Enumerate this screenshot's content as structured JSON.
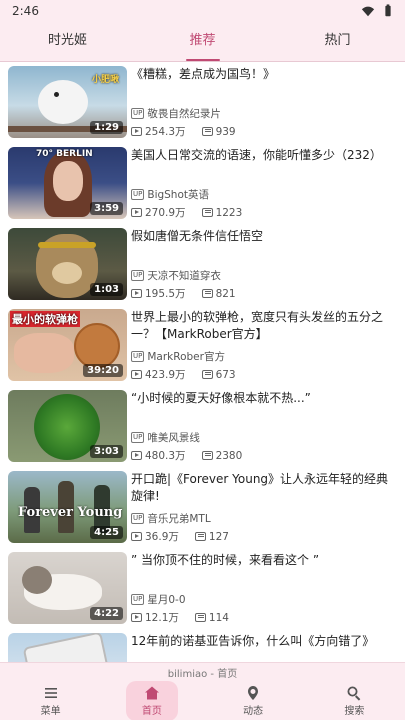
{
  "status": {
    "time": "2:46"
  },
  "tabs": [
    {
      "label": "时光姬",
      "active": false
    },
    {
      "label": "推荐",
      "active": true
    },
    {
      "label": "热门",
      "active": false
    }
  ],
  "videos": [
    {
      "title": "《糟糕，差点成为国鸟！》",
      "uploader": "敬畏自然纪录片",
      "views": "254.3万",
      "danmaku": "939",
      "duration": "1:29",
      "thumb_text": "小肥啾"
    },
    {
      "title": "美国人日常交流的语速，你能听懂多少（232）",
      "uploader": "BigShot英语",
      "views": "270.9万",
      "danmaku": "1223",
      "duration": "3:59",
      "thumb_text": "70° BERLIN"
    },
    {
      "title": "假如唐僧无条件信任悟空",
      "uploader": "天凉不知道穿衣",
      "views": "195.5万",
      "danmaku": "821",
      "duration": "1:03",
      "thumb_text": ""
    },
    {
      "title": "世界上最小的软弹枪，宽度只有头发丝的五分之一？【MarkRober官方】",
      "uploader": "MarkRober官方",
      "views": "423.9万",
      "danmaku": "673",
      "duration": "39:20",
      "thumb_text": "最小的软弹枪"
    },
    {
      "title": "“小时候的夏天好像根本就不热...”",
      "uploader": "唯美风景线",
      "views": "480.3万",
      "danmaku": "2380",
      "duration": "3:03",
      "thumb_text": ""
    },
    {
      "title": "开口跪|《Forever Young》让人永远年轻的经典旋律!",
      "uploader": "音乐兄弟MTL",
      "views": "36.9万",
      "danmaku": "127",
      "duration": "4:25",
      "thumb_text": "Forever Young"
    },
    {
      "title": "” 当你顶不住的时候，来看看这个 ”",
      "uploader": "星月0-0",
      "views": "12.1万",
      "danmaku": "114",
      "duration": "4:22",
      "thumb_text": ""
    },
    {
      "title": "12年前的诺基亚告诉你，什么叫《方向错了》",
      "uploader": "",
      "views": "",
      "danmaku": "",
      "duration": "",
      "thumb_text": ""
    }
  ],
  "bottom_nav": {
    "page_title": "bilimiao - 首页",
    "items": [
      {
        "label": "菜单",
        "icon": "menu-icon",
        "active": false
      },
      {
        "label": "首页",
        "icon": "home-icon",
        "active": true
      },
      {
        "label": "动态",
        "icon": "feed-icon",
        "active": false
      },
      {
        "label": "搜索",
        "icon": "search-icon",
        "active": false
      }
    ]
  },
  "colors": {
    "accent": "#c04a73",
    "header_bg": "#fcecf1",
    "active_pill": "#f9d2dd"
  }
}
